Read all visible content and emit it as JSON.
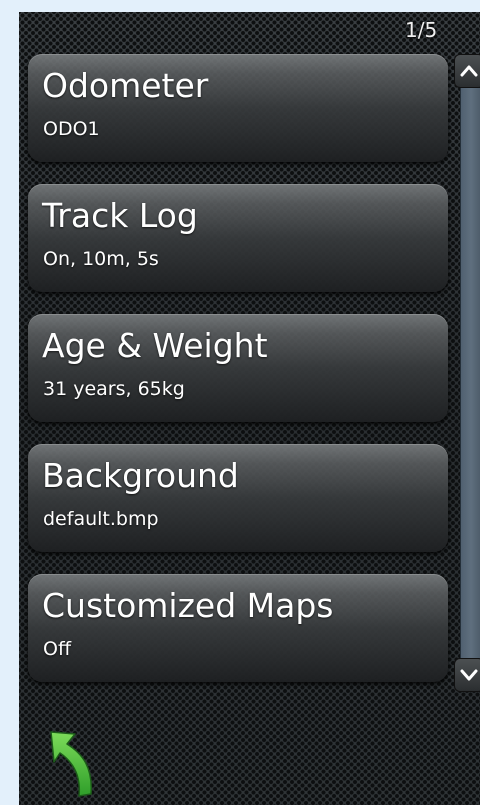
{
  "page_indicator": "1/5",
  "settings": {
    "items": [
      {
        "title": "Odometer",
        "value": "ODO1"
      },
      {
        "title": "Track Log",
        "value": "On, 10m, 5s"
      },
      {
        "title": "Age & Weight",
        "value": "31 years, 65kg"
      },
      {
        "title": "Background",
        "value": "default.bmp"
      },
      {
        "title": "Customized Maps",
        "value": "Off"
      }
    ]
  },
  "scrollbar": {
    "up_icon": "chevron-up-icon",
    "down_icon": "chevron-down-icon"
  },
  "back_button": {
    "icon": "back-arrow-icon",
    "color": "#3fbf3a"
  }
}
